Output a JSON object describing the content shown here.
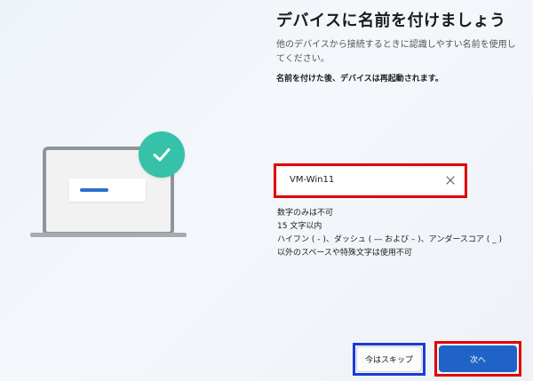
{
  "page": {
    "title": "デバイスに名前を付けましょう",
    "subtitle": "他のデバイスから接続するときに認識しやすい名前を使用してください。",
    "restart_note": "名前を付けた後、デバイスは再起動されます。"
  },
  "name_field": {
    "value": "VM-Win11"
  },
  "requirements": [
    "数字のみは不可",
    "15 文字以内",
    "ハイフン ( - )、ダッシュ ( ― および – )、アンダースコア ( _ )",
    "以外のスペースや特殊文字は使用不可"
  ],
  "buttons": {
    "skip_label": "今はスキップ",
    "next_label": "次へ"
  },
  "colors": {
    "accent": "#1f63c6",
    "check_badge": "#35c2a8",
    "highlight_red": "#e00000",
    "highlight_blue": "#1c39d6"
  },
  "icons": {
    "illustration": "laptop-icon",
    "badge": "checkmark-icon",
    "clear": "close-icon"
  }
}
